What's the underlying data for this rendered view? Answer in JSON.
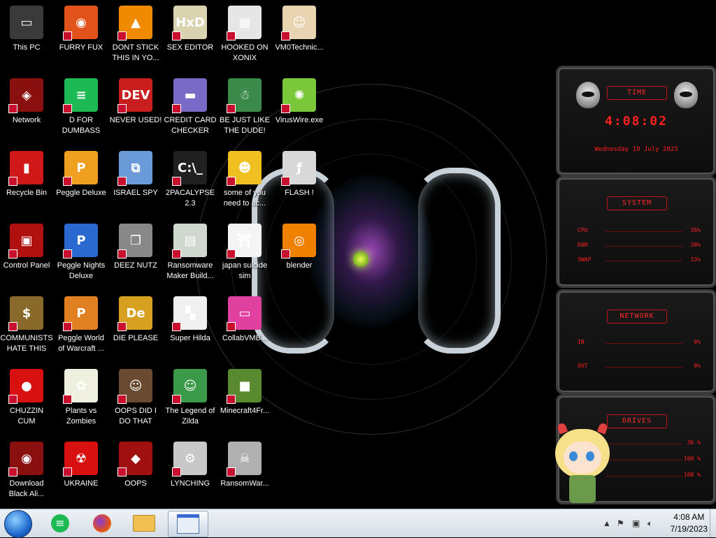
{
  "desktop": {
    "icons": [
      {
        "label": "This PC",
        "icon": "computer-icon",
        "color": "#3a3a3a",
        "glyph": "▭"
      },
      {
        "label": "FURRY FUX",
        "icon": "firefox-icon",
        "color": "#e2531c",
        "glyph": "◉"
      },
      {
        "label": "DONT STICK THIS IN YO...",
        "icon": "vlc-cone-icon",
        "color": "#f08a00",
        "glyph": "▲"
      },
      {
        "label": "SEX EDITOR",
        "icon": "hxd-editor-icon",
        "color": "#d9d3b0",
        "glyph": "HxD"
      },
      {
        "label": "HOOKED ON XONIX",
        "icon": "xonix-game-icon",
        "color": "#e6e6e6",
        "glyph": "▦"
      },
      {
        "label": "VM0Technic...",
        "icon": "doctor-icon",
        "color": "#e8d4b0",
        "glyph": "☺"
      },
      {
        "label": "Network",
        "icon": "network-icon",
        "color": "#8a1010",
        "glyph": "◈"
      },
      {
        "label": "D FOR DUMBASS",
        "icon": "docs-icon",
        "color": "#1db954",
        "glyph": "≡"
      },
      {
        "label": "NEVER USED!",
        "icon": "devcpp-icon",
        "color": "#c81e1e",
        "glyph": "DEV"
      },
      {
        "label": "CREDIT CARD CHECKER",
        "icon": "credit-card-icon",
        "color": "#7a6ac8",
        "glyph": "▬"
      },
      {
        "label": "BE JUST LIKE THE DUDE!",
        "icon": "gnome-icon",
        "color": "#3b8a4a",
        "glyph": "☃"
      },
      {
        "label": "VirusWire.exe",
        "icon": "lime-icon",
        "color": "#7ac83a",
        "glyph": "✺"
      },
      {
        "label": "Recycle Bin",
        "icon": "recycle-bin-icon",
        "color": "#d01818",
        "glyph": "▮"
      },
      {
        "label": "Peggle Deluxe",
        "icon": "peggle-icon",
        "color": "#f0a020",
        "glyph": "P"
      },
      {
        "label": "ISRAEL SPY",
        "icon": "spy-network-icon",
        "color": "#6a9ad8",
        "glyph": "⧉"
      },
      {
        "label": "2PACALYPSE 2.3",
        "icon": "terminal-icon",
        "color": "#202020",
        "glyph": "C:\\_"
      },
      {
        "label": "some of you need to ac...",
        "icon": "dog-icon",
        "color": "#f0c020",
        "glyph": "☻"
      },
      {
        "label": "FLASH !",
        "icon": "flash-icon",
        "color": "#d8d8d8",
        "glyph": "ƒ"
      },
      {
        "label": "Control Panel",
        "icon": "control-panel-icon",
        "color": "#b01010",
        "glyph": "▣"
      },
      {
        "label": "Peggle Nights Deluxe",
        "icon": "peggle-nights-icon",
        "color": "#2a6ad0",
        "glyph": "P"
      },
      {
        "label": "DEEZ NUTZ",
        "icon": "window-stack-icon",
        "color": "#888888",
        "glyph": "❐"
      },
      {
        "label": "Ransomware Maker Build...",
        "icon": "app-window-icon",
        "color": "#d0d8d0",
        "glyph": "▤"
      },
      {
        "label": "japan suicide sim",
        "icon": "japanese-doc-icon",
        "color": "#f4f4f4",
        "glyph": "⛩"
      },
      {
        "label": "blender",
        "icon": "blender-icon",
        "color": "#f08000",
        "glyph": "◎"
      },
      {
        "label": "COMMUNISTS HATE THIS G...",
        "icon": "money-bag-icon",
        "color": "#8a6a2a",
        "glyph": "$"
      },
      {
        "label": "Peggle World of Warcraft ...",
        "icon": "peggle-wow-icon",
        "color": "#e08020",
        "glyph": "P"
      },
      {
        "label": "DIE PLEASE",
        "icon": "after-effects-icon",
        "color": "#d8a020",
        "glyph": "De"
      },
      {
        "label": "Super Hilda",
        "icon": "pixel-dog-icon",
        "color": "#f0f0f0",
        "glyph": "▚"
      },
      {
        "label": "CollabVMB...",
        "icon": "monitor-pink-icon",
        "color": "#e040a0",
        "glyph": "▭"
      },
      {
        "label": "CHUZZIN CUM",
        "icon": "chuzzle-icon",
        "color": "#d81010",
        "glyph": "●"
      },
      {
        "label": "Plants vs Zombies",
        "icon": "flower-icon",
        "color": "#f0f0e0",
        "glyph": "✿"
      },
      {
        "label": "OOPS DID I DO THAT",
        "icon": "portrait-icon",
        "color": "#6a4a30",
        "glyph": "☺"
      },
      {
        "label": "The Legend of Zilda",
        "icon": "zelda-link-icon",
        "color": "#3a9a4a",
        "glyph": "☺"
      },
      {
        "label": "Minecraft4Fr...",
        "icon": "minecraft-icon",
        "color": "#5a8a30",
        "glyph": "■"
      },
      {
        "label": "Download Black Ali...",
        "icon": "alien-ware-icon",
        "color": "#8a1010",
        "glyph": "◉"
      },
      {
        "label": "UKRAINE",
        "icon": "radiation-icon",
        "color": "#d81010",
        "glyph": "☢"
      },
      {
        "label": "OOPS",
        "icon": "alien-box-icon",
        "color": "#a01010",
        "glyph": "◆"
      },
      {
        "label": "LYNCHING",
        "icon": "gear-badge-icon",
        "color": "#c8c8c8",
        "glyph": "⚙"
      },
      {
        "label": "RansomWar...",
        "icon": "skull-icon",
        "color": "#b0b0b0",
        "glyph": "☠"
      }
    ]
  },
  "gadgets": {
    "time": {
      "title": "TIME",
      "clock": "4:08:02",
      "date": "Wednesday 19 July 2023"
    },
    "system": {
      "title": "SYSTEM",
      "rows": [
        {
          "k": "CPU",
          "v": "36%"
        },
        {
          "k": "RAM",
          "v": "38%"
        },
        {
          "k": "SWAP",
          "v": "33%"
        }
      ]
    },
    "network": {
      "title": "NETWORK",
      "rows": [
        {
          "k": "IN",
          "v": "0%"
        },
        {
          "k": "OUT",
          "v": "0%"
        }
      ]
    },
    "drives": {
      "title": "DRIVES",
      "rows": [
        {
          "k": "",
          "v": "36 %"
        },
        {
          "k": "",
          "v": "100 %"
        },
        {
          "k": "",
          "v": "100 %"
        }
      ]
    }
  },
  "taskbar": {
    "pinned": [
      "docs-icon",
      "firefox-icon",
      "file-explorer-icon",
      "keyboard-window-icon"
    ],
    "tray": {
      "time": "4:08 AM",
      "date": "7/19/2023"
    }
  },
  "colors": {
    "accent": "#ff2020",
    "taskbar": "#dfe6ee"
  }
}
